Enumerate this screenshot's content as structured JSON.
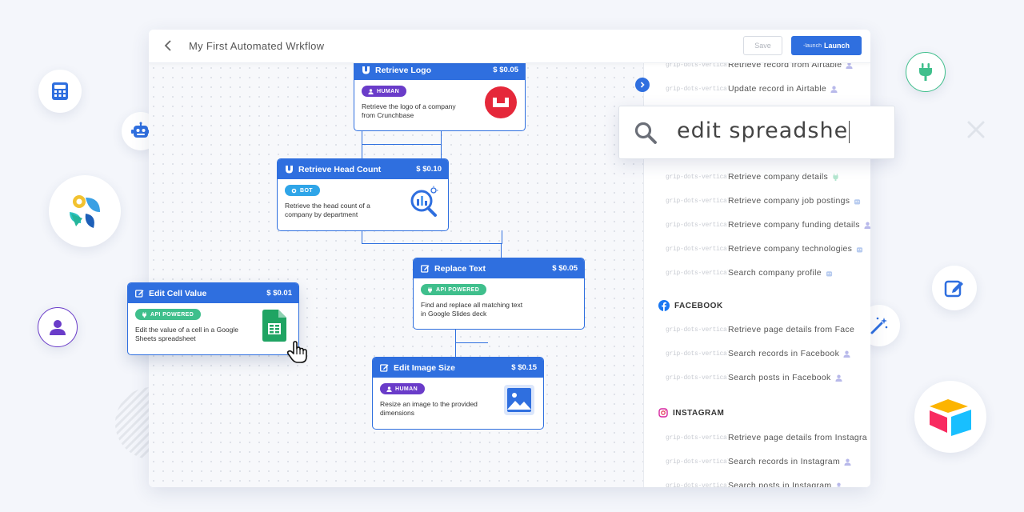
{
  "header": {
    "title": "My First Automated Wrkflow",
    "save_label": "Save",
    "launch_icon_text": "-launch",
    "launch_label": "Launch"
  },
  "search": {
    "value": "edit spreadshe"
  },
  "nodes": [
    {
      "title": "Retrieve Logo",
      "price": "$ $0.05",
      "badge": "HUMAN",
      "desc": "Retrieve the logo of a company from Crunchbase",
      "icon": "magnet-icon",
      "image": "crunchbase-logo"
    },
    {
      "title": "Retrieve Head Count",
      "price": "$ $0.10",
      "badge": "BOT",
      "desc": "Retrieve the head count of a company by department",
      "icon": "magnet-icon",
      "image": "headcount-analytics-icon"
    },
    {
      "title": "Replace Text",
      "price": "$ $0.05",
      "badge": "API POWERED",
      "desc": "Find and replace all matching text in Google Slides deck",
      "icon": "edit-icon",
      "image": ""
    },
    {
      "title": "Edit Cell Value",
      "price": "$ $0.01",
      "badge": "API POWERED",
      "desc": "Edit the value of a cell in a Google Sheets spreadsheet",
      "icon": "edit-icon",
      "image": "google-sheets-icon"
    },
    {
      "title": "Edit Image Size",
      "price": "$ $0.15",
      "badge": "HUMAN",
      "desc": "Resize an image to the provided dimensions",
      "icon": "edit-icon",
      "image": "image-icon"
    }
  ],
  "panel": {
    "grip_text": "grip-dots-vertical",
    "top_items": [
      {
        "label": "Retrieve record from Airtable",
        "suffix": "user-icon"
      },
      {
        "label": "Update record in Airtable",
        "suffix": "user-icon"
      }
    ],
    "company_items": [
      {
        "label": "Retrieve company details",
        "suffix": "plug-icon"
      },
      {
        "label": "Retrieve company job postings",
        "suffix": "robot-icon"
      },
      {
        "label": "Retrieve company funding details",
        "suffix": "user-icon"
      },
      {
        "label": "Retrieve company technologies",
        "suffix": "robot-icon"
      },
      {
        "label": "Search company profile",
        "suffix": "robot-icon"
      }
    ],
    "facebook": {
      "heading": "FACEBOOK",
      "items": [
        {
          "label": "Retrieve page details from Face",
          "suffix": ""
        },
        {
          "label": "Search records in Facebook",
          "suffix": "user-icon"
        },
        {
          "label": "Search posts in Facebook",
          "suffix": "user-icon"
        }
      ]
    },
    "instagram": {
      "heading": "INSTAGRAM",
      "items": [
        {
          "label": "Retrieve page details from Instagra",
          "suffix": ""
        },
        {
          "label": "Search records in Instagram",
          "suffix": "user-icon"
        },
        {
          "label": "Search posts in Instagram",
          "suffix": "user-icon"
        }
      ]
    }
  },
  "colors": {
    "primary": "#2f6fdf",
    "human_badge": "#6a3cc9",
    "bot_badge": "#2fa5e8",
    "api_badge": "#3fbf8c"
  },
  "floating_icons": [
    "calculator-icon",
    "robot-icon",
    "app-logo-icon",
    "user-icon",
    "plug-icon",
    "edit-icon",
    "magic-wand-icon",
    "airtable-logo-icon"
  ]
}
